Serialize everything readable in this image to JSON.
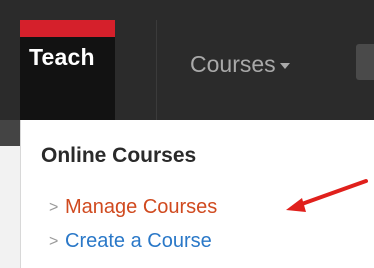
{
  "navbar": {
    "brand_label": "Teach",
    "courses_label": "Courses",
    "courses_icon": "caret-down-icon"
  },
  "menu": {
    "section_title": "Online Courses",
    "items": [
      {
        "label": "Manage Courses",
        "icon": "chevron-right-icon"
      },
      {
        "label": "Create a Course",
        "icon": "chevron-right-icon"
      }
    ]
  },
  "colors": {
    "brand_accent": "#d5202b",
    "manage_link": "#d04a1f",
    "create_link": "#2a78c8",
    "annotation_arrow": "#e0201c"
  }
}
